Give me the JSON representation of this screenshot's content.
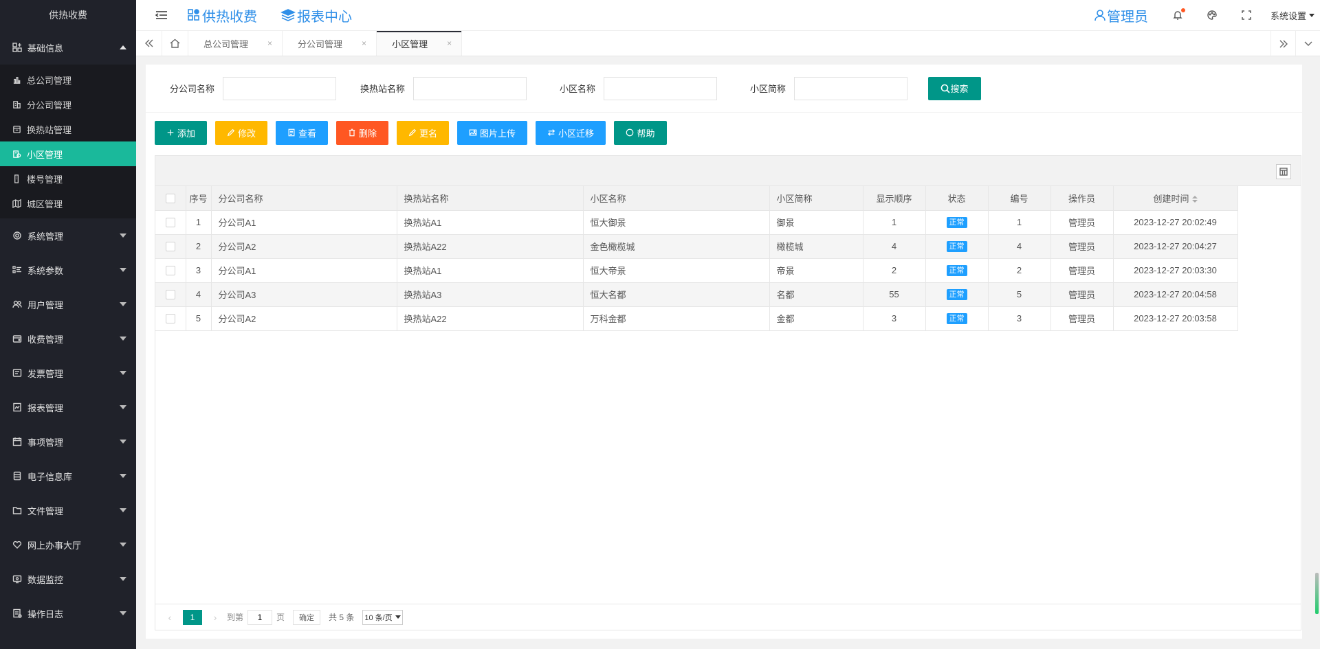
{
  "sidebar": {
    "logo": "供热收费",
    "groups": [
      {
        "label": "基础信息",
        "expanded": true,
        "icon": "grid-plus-icon",
        "items": [
          {
            "label": "总公司管理",
            "active": false,
            "icon": "bar-chart-icon"
          },
          {
            "label": "分公司管理",
            "active": false,
            "icon": "building-icon"
          },
          {
            "label": "换热站管理",
            "active": false,
            "icon": "station-icon"
          },
          {
            "label": "小区管理",
            "active": true,
            "icon": "community-icon"
          },
          {
            "label": "楼号管理",
            "active": false,
            "icon": "tower-icon"
          },
          {
            "label": "城区管理",
            "active": false,
            "icon": "map-icon"
          }
        ]
      },
      {
        "label": "系统管理",
        "icon": "gear-icon"
      },
      {
        "label": "系统参数",
        "icon": "list-icon"
      },
      {
        "label": "用户管理",
        "icon": "users-icon"
      },
      {
        "label": "收费管理",
        "icon": "wallet-icon"
      },
      {
        "label": "发票管理",
        "icon": "invoice-icon"
      },
      {
        "label": "报表管理",
        "icon": "report-icon"
      },
      {
        "label": "事项管理",
        "icon": "calendar-icon"
      },
      {
        "label": "电子信息库",
        "icon": "database-icon"
      },
      {
        "label": "文件管理",
        "icon": "folder-icon"
      },
      {
        "label": "网上办事大厅",
        "icon": "heart-icon"
      },
      {
        "label": "数据监控",
        "icon": "monitor-icon"
      },
      {
        "label": "操作日志",
        "icon": "log-icon"
      }
    ]
  },
  "header": {
    "nav": [
      {
        "label": "供热收费",
        "icon": "apps-icon"
      },
      {
        "label": "报表中心",
        "icon": "layers-icon"
      }
    ],
    "admin": "管理员",
    "settings": "系统设置"
  },
  "tabs": {
    "items": [
      {
        "label": "总公司管理",
        "active": false
      },
      {
        "label": "分公司管理",
        "active": false
      },
      {
        "label": "小区管理",
        "active": true
      }
    ],
    "close": "×"
  },
  "search": {
    "fields": [
      {
        "label": "分公司名称",
        "value": ""
      },
      {
        "label": "换热站名称",
        "value": ""
      },
      {
        "label": "小区名称",
        "value": ""
      },
      {
        "label": "小区简称",
        "value": ""
      }
    ],
    "button": "搜索"
  },
  "toolbar": {
    "buttons": [
      {
        "label": "添加",
        "color": "#009688",
        "icon": "plus-icon"
      },
      {
        "label": "修改",
        "color": "#ffb800",
        "icon": "pencil-icon"
      },
      {
        "label": "查看",
        "color": "#1e9fff",
        "icon": "document-icon"
      },
      {
        "label": "删除",
        "color": "#ff5722",
        "icon": "trash-icon"
      },
      {
        "label": "更名",
        "color": "#ffb800",
        "icon": "pencil-icon"
      },
      {
        "label": "图片上传",
        "color": "#1e9fff",
        "icon": "image-icon"
      },
      {
        "label": "小区迁移",
        "color": "#1e9fff",
        "icon": "swap-icon"
      },
      {
        "label": "帮助",
        "color": "#009688",
        "icon": "help-icon"
      }
    ]
  },
  "table": {
    "columns": [
      "序号",
      "分公司名称",
      "换热站名称",
      "小区名称",
      "小区简称",
      "显示顺序",
      "状态",
      "编号",
      "操作员",
      "创建时间"
    ],
    "rows": [
      {
        "no": "1",
        "branch": "分公司A1",
        "station": "换热站A1",
        "name": "恒大御景",
        "short": "御景",
        "order": "1",
        "status": "正常",
        "code": "1",
        "operator": "管理员",
        "created": "2023-12-27 20:02:49"
      },
      {
        "no": "2",
        "branch": "分公司A2",
        "station": "换热站A22",
        "name": "金色橄榄城",
        "short": "橄榄城",
        "order": "4",
        "status": "正常",
        "code": "4",
        "operator": "管理员",
        "created": "2023-12-27 20:04:27"
      },
      {
        "no": "3",
        "branch": "分公司A1",
        "station": "换热站A1",
        "name": "恒大帝景",
        "short": "帝景",
        "order": "2",
        "status": "正常",
        "code": "2",
        "operator": "管理员",
        "created": "2023-12-27 20:03:30"
      },
      {
        "no": "4",
        "branch": "分公司A3",
        "station": "换热站A3",
        "name": "恒大名都",
        "short": "名都",
        "order": "55",
        "status": "正常",
        "code": "5",
        "operator": "管理员",
        "created": "2023-12-27 20:04:58"
      },
      {
        "no": "5",
        "branch": "分公司A2",
        "station": "换热站A22",
        "name": "万科金都",
        "short": "金都",
        "order": "3",
        "status": "正常",
        "code": "3",
        "operator": "管理员",
        "created": "2023-12-27 20:03:58"
      }
    ]
  },
  "pager": {
    "current": "1",
    "goto_label": "到第",
    "goto_value": "1",
    "page_unit": "页",
    "confirm": "确定",
    "total": "共 5 条",
    "page_size": "10 条/页"
  }
}
